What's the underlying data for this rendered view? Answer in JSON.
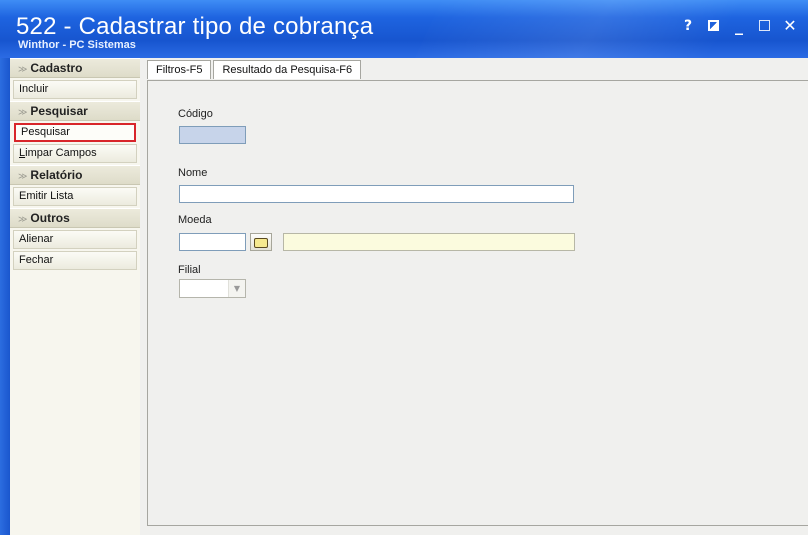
{
  "window": {
    "title": "522 - Cadastrar tipo de cobrança",
    "subtitle": "Winthor - PC Sistemas",
    "controls": {
      "help": "?",
      "minimize": "_",
      "close": "✕"
    }
  },
  "sidebar": {
    "sections": [
      {
        "title": "Cadastro",
        "items": [
          "Incluir"
        ]
      },
      {
        "title": "Pesquisar",
        "items": [
          "Pesquisar",
          "Limpar Campos"
        ]
      },
      {
        "title": "Relatório",
        "items": [
          "Emitir Lista"
        ]
      },
      {
        "title": "Outros",
        "items": [
          "Alienar",
          "Fechar"
        ]
      }
    ]
  },
  "tabs": [
    {
      "label": "Filtros-F5"
    },
    {
      "label": "Resultado da Pesquisa-F6"
    }
  ],
  "form": {
    "codigo": {
      "label": "Código",
      "value": ""
    },
    "nome": {
      "label": "Nome",
      "value": ""
    },
    "moeda": {
      "label": "Moeda",
      "value": "",
      "description": ""
    },
    "filial": {
      "label": "Filial",
      "value": ""
    }
  },
  "colors": {
    "titlebar": "#1e64e0",
    "highlight": "#d8252a",
    "codigo_field": "#c7d4ea",
    "description_field": "#fbfbde"
  },
  "icons": [
    "help-icon",
    "restore-icon",
    "minimize-icon",
    "maximize-icon",
    "close-icon",
    "chevron-icon",
    "lookup-hand-icon",
    "dropdown-arrow-icon"
  ]
}
